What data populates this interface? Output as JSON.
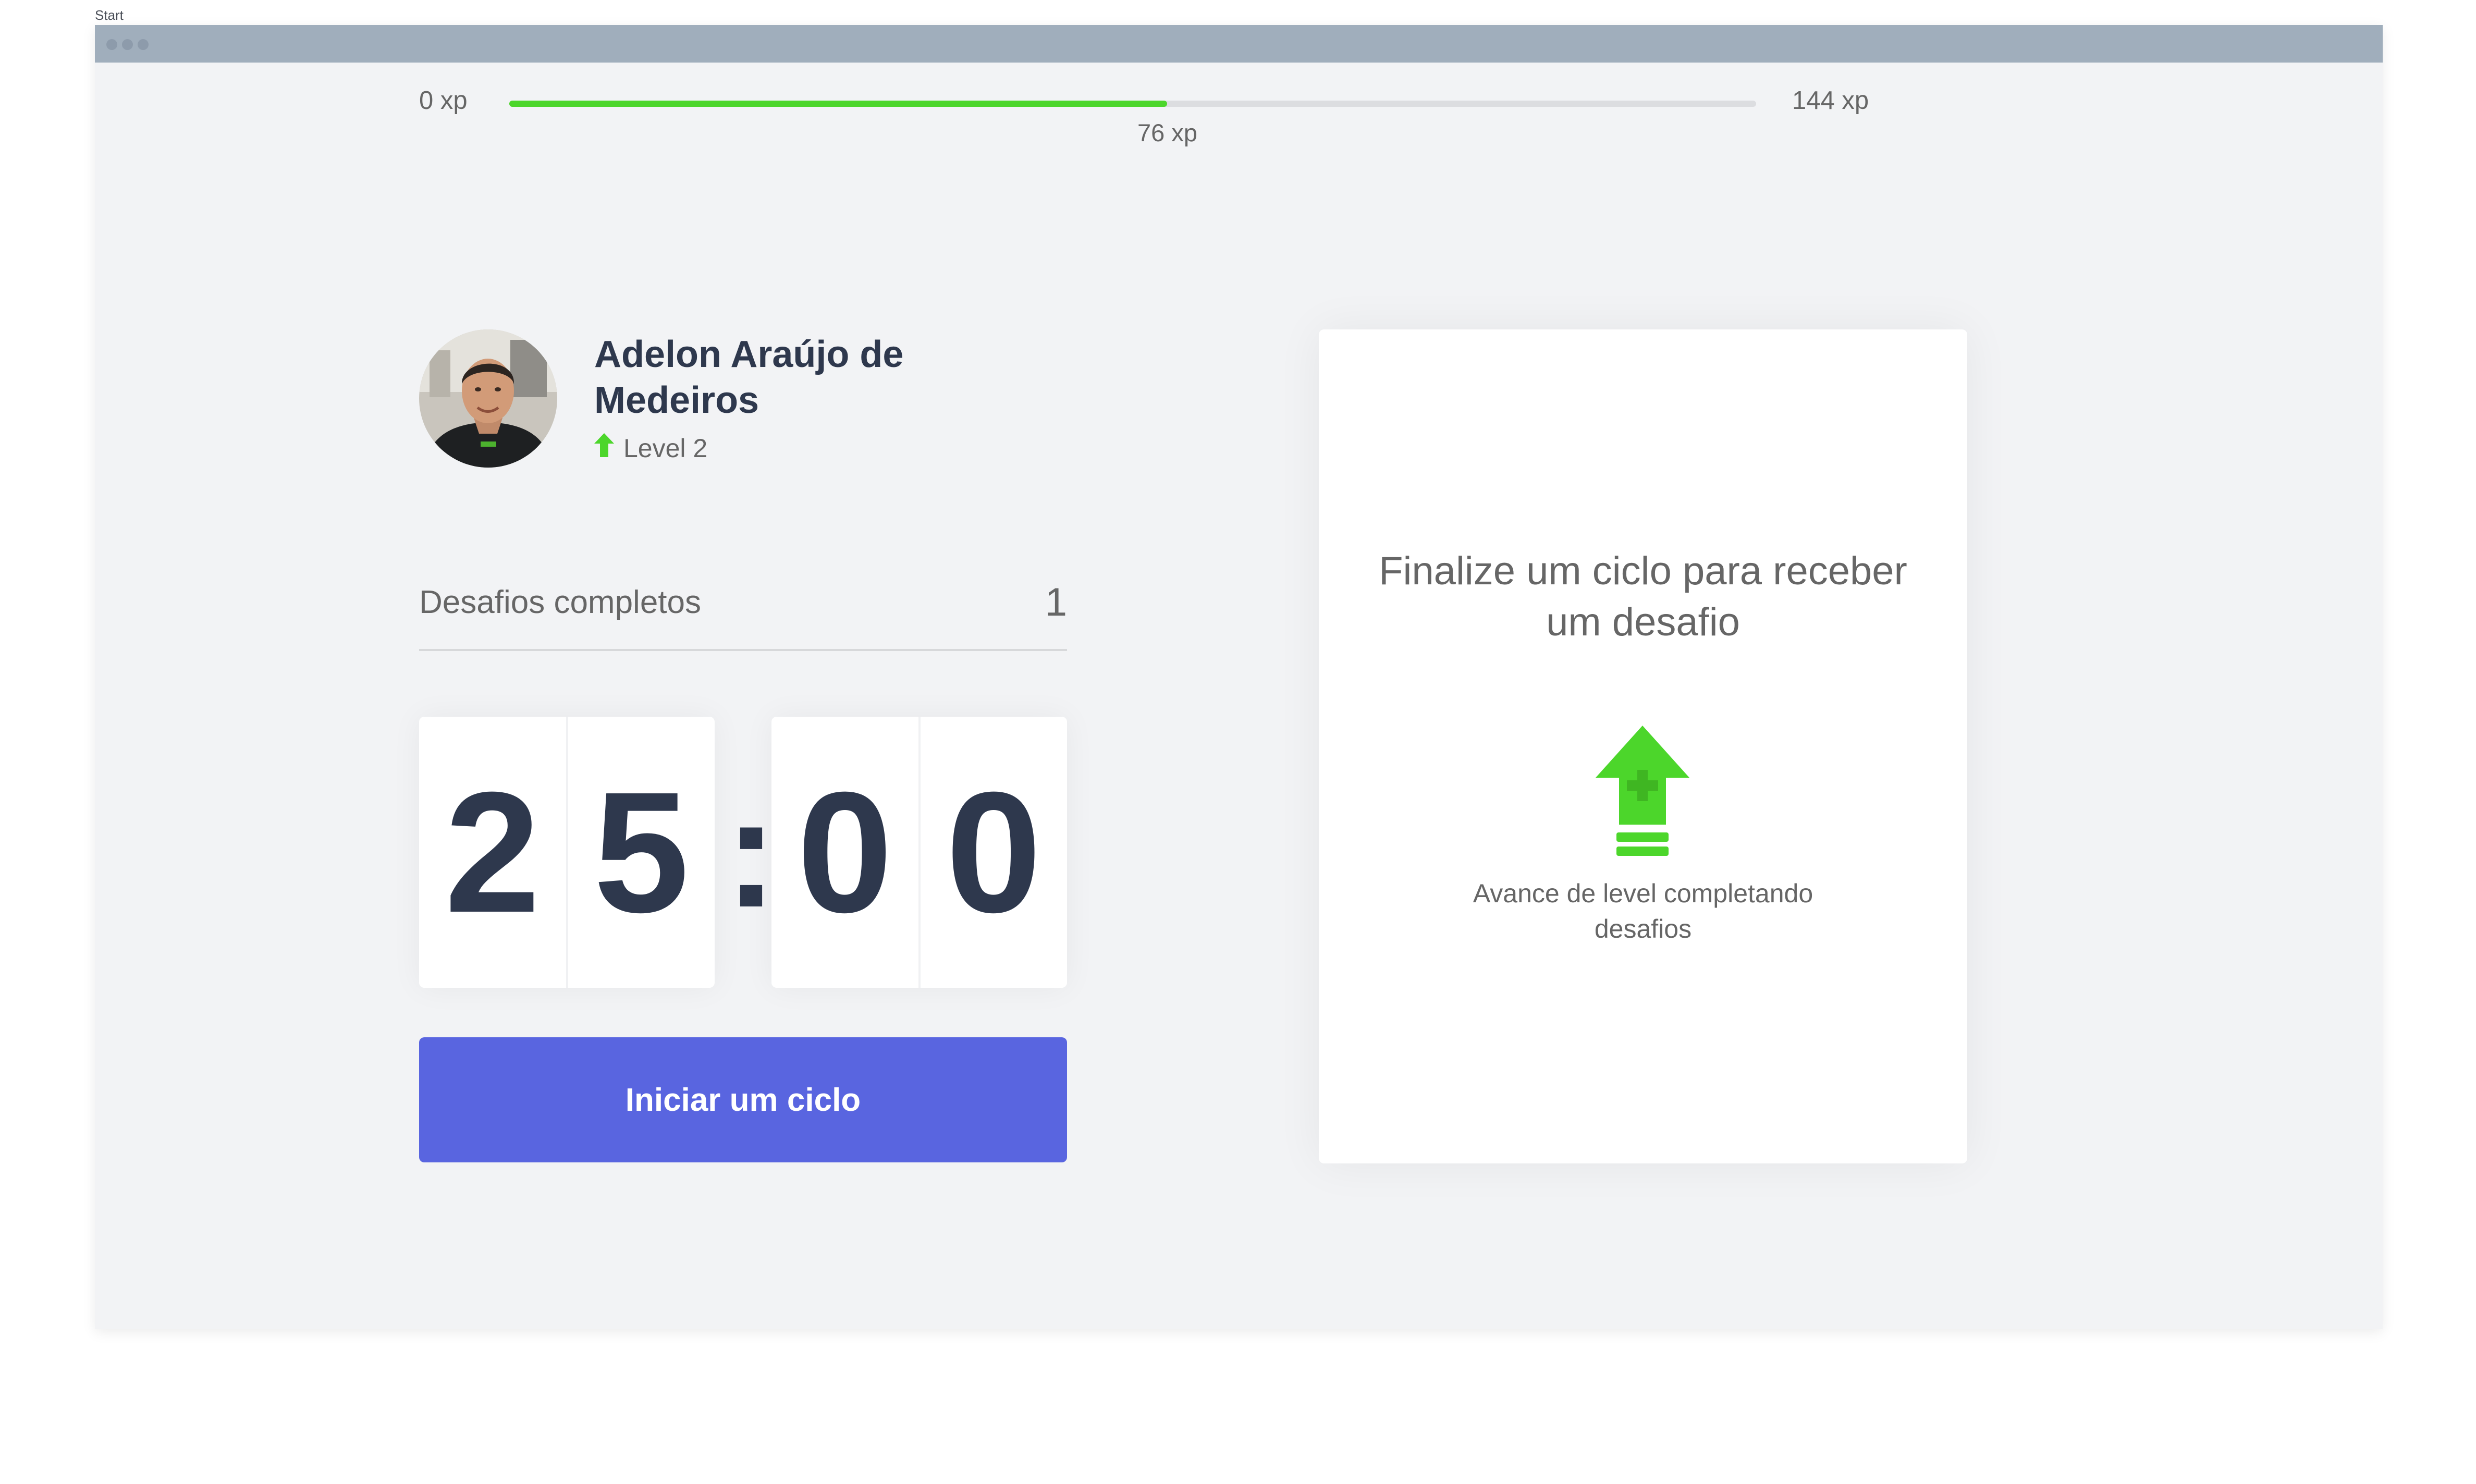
{
  "frame": {
    "label": "Start"
  },
  "experience": {
    "min_label": "0 xp",
    "max_label": "144 xp",
    "current_label": "76 xp",
    "progress_fraction": 0.5278
  },
  "profile": {
    "name": "Adelon Araújo de Medeiros",
    "level_label": "Level 2",
    "level_icon": "level-up-arrow-icon"
  },
  "challenges": {
    "label": "Desafios completos",
    "count": "1"
  },
  "countdown": {
    "minute_left": "2",
    "minute_right": "5",
    "separator": ":",
    "second_left": "0",
    "second_right": "0"
  },
  "actions": {
    "start_cycle": "Iniciar um ciclo"
  },
  "challenge_card": {
    "title": "Finalize um ciclo para receber um desafio",
    "icon": "level-up-icon",
    "text": "Avance de level completando desafios"
  },
  "colors": {
    "accent_green": "#4cd62b",
    "button_blue": "#5965e0",
    "title_dark": "#2e384d",
    "text_gray": "#666666",
    "background": "#f2f3f5"
  }
}
